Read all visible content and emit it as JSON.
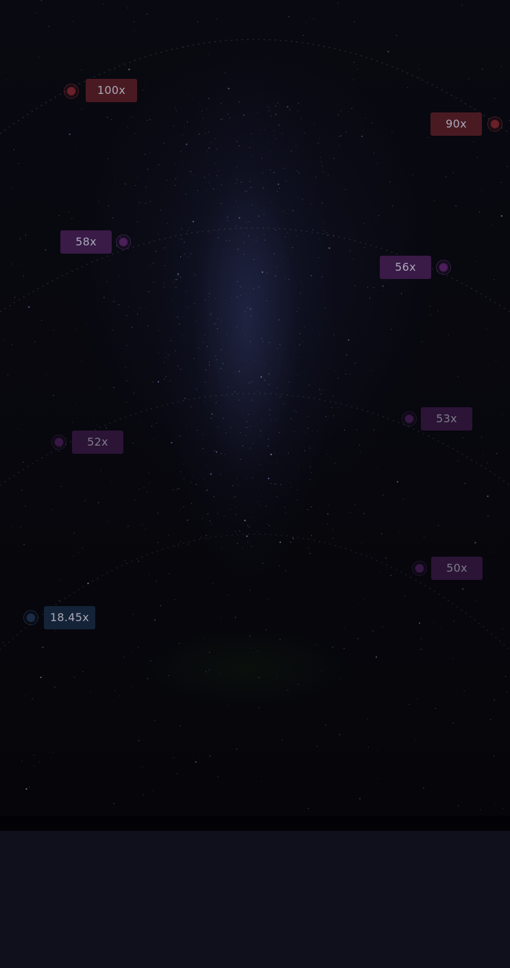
{
  "multipliers": [
    {
      "id": "100x",
      "label": "100x",
      "tier": "red"
    },
    {
      "id": "90x",
      "label": "90x",
      "tier": "red"
    },
    {
      "id": "58x",
      "label": "58x",
      "tier": "purple"
    },
    {
      "id": "56x",
      "label": "56x",
      "tier": "purple"
    },
    {
      "id": "53x",
      "label": "53x",
      "tier": "purple-dim"
    },
    {
      "id": "52x",
      "label": "52x",
      "tier": "purple-dim"
    },
    {
      "id": "50x",
      "label": "50x",
      "tier": "purple-dim"
    },
    {
      "id": "18_45x",
      "label": "18.45x",
      "tier": "blue"
    }
  ],
  "colors": {
    "background": "#07070d",
    "bottom_panel": "#10101d",
    "red_badge": "#4a1a22",
    "red_planet": "#6a2029",
    "purple_badge": "#3a1a47",
    "purple_planet": "#4a1f5a",
    "blue_badge": "#152338",
    "blue_planet": "#1a2c45",
    "badge_text": "#a9a9b8"
  }
}
